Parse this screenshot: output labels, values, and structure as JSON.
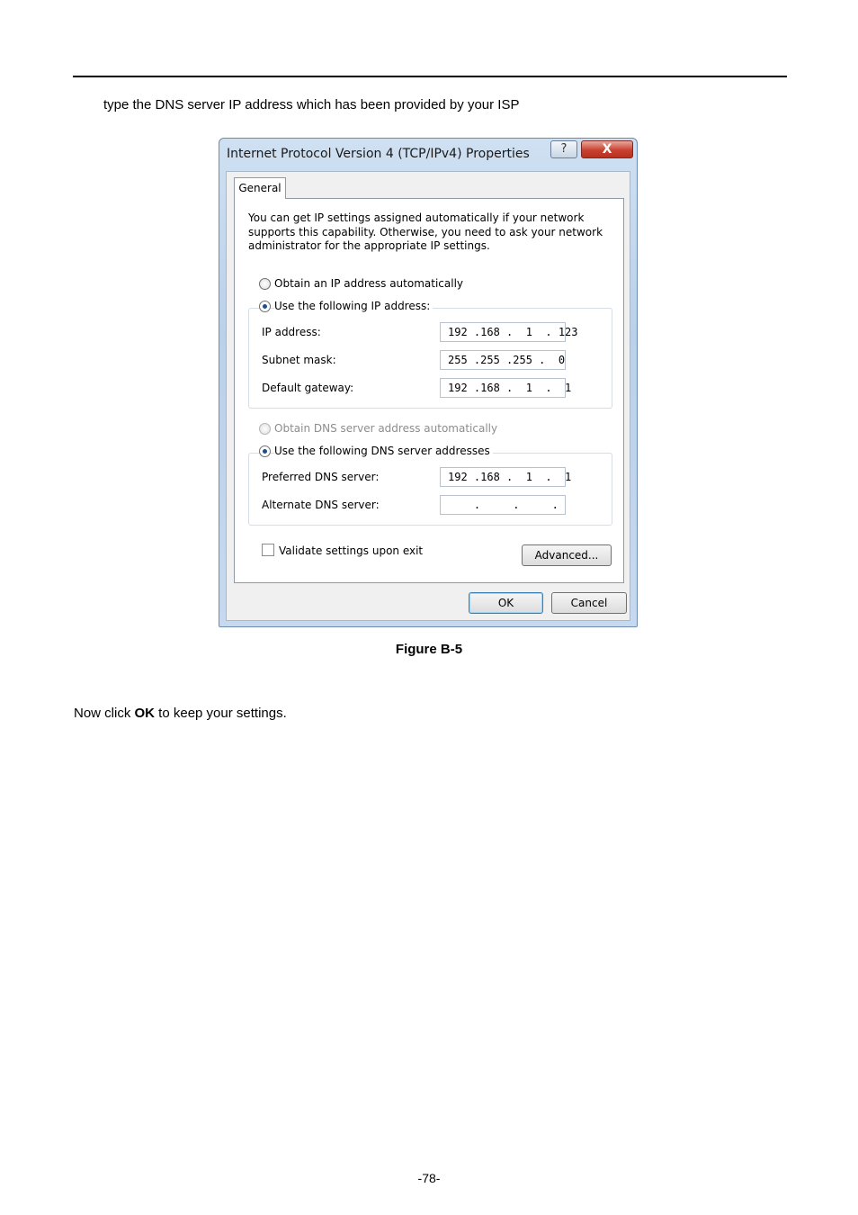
{
  "document": {
    "intro": "type the DNS server IP address which has been provided by your ISP",
    "caption": "Figure B-5",
    "body_prefix": "Now click ",
    "body_bold": "OK",
    "body_suffix": " to keep your settings.",
    "page_number": "-78-"
  },
  "dialog": {
    "title": "Internet Protocol Version 4 (TCP/IPv4) Properties",
    "help_label": "?",
    "close_label": "X",
    "tab_general": "General",
    "description": "You can get IP settings assigned automatically if your network supports this capability. Otherwise, you need to ask your network administrator for the appropriate IP settings.",
    "ip_mode": {
      "auto_label": "Obtain an IP address automatically",
      "manual_label": "Use the following IP address:",
      "selected": "manual"
    },
    "ip_address": {
      "label": "IP address:",
      "value": "192 .168 .  1  . 123"
    },
    "subnet_mask": {
      "label": "Subnet mask:",
      "value": "255 .255 .255 .  0"
    },
    "default_gateway": {
      "label": "Default gateway:",
      "value": "192 .168 .  1  .  1"
    },
    "dns_mode": {
      "auto_label": "Obtain DNS server address automatically",
      "manual_label": "Use the following DNS server addresses",
      "selected": "manual"
    },
    "preferred_dns": {
      "label": "Preferred DNS server:",
      "value": "192 .168 .  1  .  1"
    },
    "alternate_dns": {
      "label": "Alternate DNS server:",
      "value": "    .     .     ."
    },
    "validate_label": "Validate settings upon exit",
    "validate_checked": false,
    "advanced_label": "Advanced...",
    "ok_label": "OK",
    "cancel_label": "Cancel"
  }
}
